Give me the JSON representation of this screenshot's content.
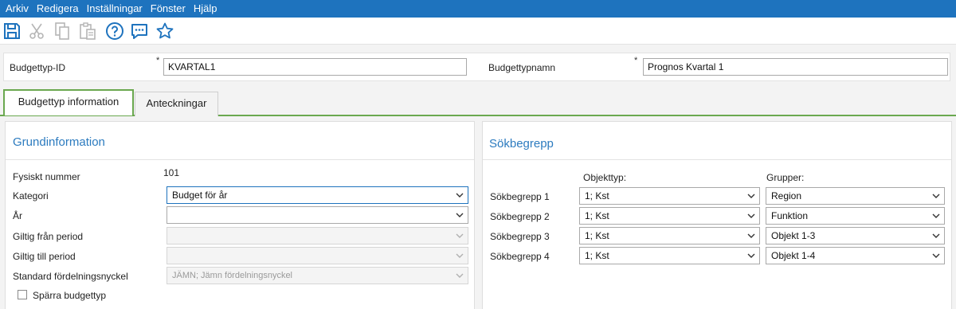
{
  "menu": {
    "items": [
      "Arkiv",
      "Redigera",
      "Inställningar",
      "Fönster",
      "Hjälp"
    ]
  },
  "toolbar": {
    "icons": [
      "save-icon",
      "cut-icon",
      "copy-icon",
      "paste-icon",
      "help-icon",
      "chat-icon",
      "favorite-star-icon"
    ],
    "accent": "#1e73be"
  },
  "header": {
    "budget_type_id_label": "Budgettyp-ID",
    "budget_type_id_value": "KVARTAL1",
    "budget_type_name_label": "Budgettypnamn",
    "budget_type_name_value": "Prognos Kvartal 1",
    "required_marker": "*"
  },
  "tabs": [
    {
      "label": "Budgettyp information",
      "active": true
    },
    {
      "label": "Anteckningar",
      "active": false
    }
  ],
  "basic_info": {
    "title": "Grundinformation",
    "physical_number_label": "Fysiskt nummer",
    "physical_number_value": "101",
    "category_label": "Kategori",
    "category_value": "Budget för år",
    "year_label": "År",
    "year_value": "",
    "valid_from_label": "Giltig från period",
    "valid_from_value": "",
    "valid_to_label": "Giltig till period",
    "valid_to_value": "",
    "default_key_label": "Standard fördelningsnyckel",
    "default_key_value": "JÄMN; Jämn fördelningsnyckel",
    "lock_label": "Spärra budgettyp",
    "lock_checked": false
  },
  "search_terms": {
    "title": "Sökbegrepp",
    "object_type_header": "Objekttyp:",
    "groups_header": "Grupper:",
    "rows": [
      {
        "label": "Sökbegrepp 1",
        "object_type": "1; Kst",
        "group": "Region"
      },
      {
        "label": "Sökbegrepp 2",
        "object_type": "1; Kst",
        "group": "Funktion"
      },
      {
        "label": "Sökbegrepp 3",
        "object_type": "1; Kst",
        "group": "Objekt 1-3"
      },
      {
        "label": "Sökbegrepp 4",
        "object_type": "1; Kst",
        "group": "Objekt 1-4"
      }
    ]
  }
}
